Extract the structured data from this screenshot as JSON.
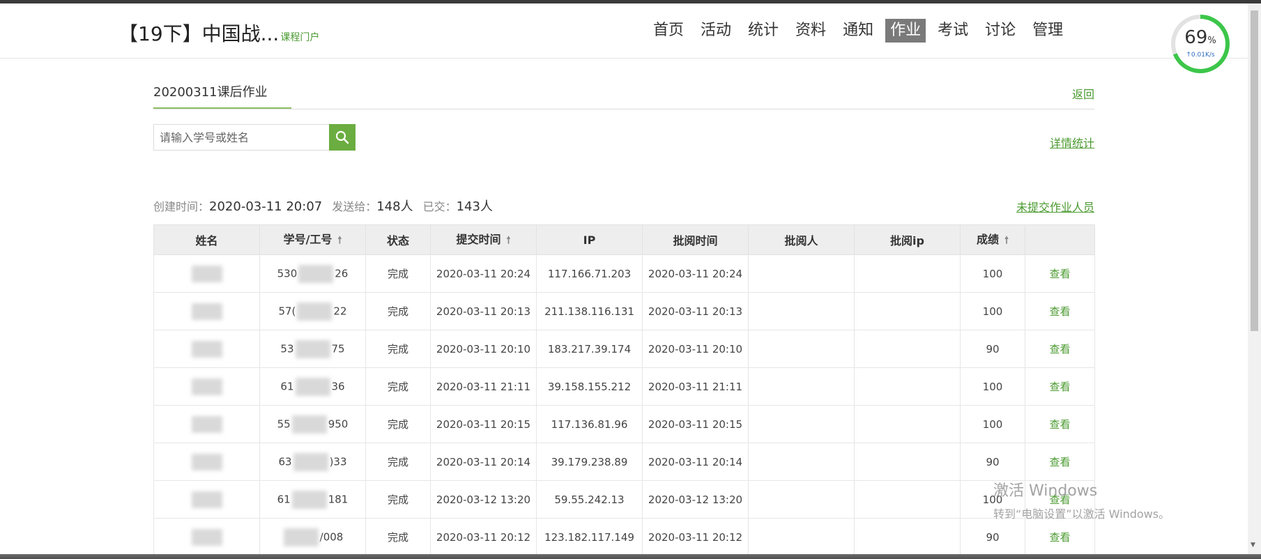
{
  "header": {
    "course_title": "【19下】中国战...",
    "course_portal": "课程门户",
    "nav": [
      {
        "label": "首页",
        "active": false
      },
      {
        "label": "活动",
        "active": false
      },
      {
        "label": "统计",
        "active": false
      },
      {
        "label": "资料",
        "active": false
      },
      {
        "label": "通知",
        "active": false
      },
      {
        "label": "作业",
        "active": true
      },
      {
        "label": "考试",
        "active": false
      },
      {
        "label": "讨论",
        "active": false
      },
      {
        "label": "管理",
        "active": false
      }
    ]
  },
  "meter": {
    "percent": "69",
    "unit": "%",
    "speed": "↑0.01K/s",
    "value": 0.69
  },
  "assignment": {
    "title": "20200311课后作业",
    "back": "返回",
    "search_placeholder": "请输入学号或姓名",
    "detail_stats": "详情统计",
    "created_label": "创建时间：",
    "created_value": "2020-03-11 20:07",
    "sent_label": "发送给：",
    "sent_value": "148人",
    "submitted_label": "已交：",
    "submitted_value": "143人",
    "unsubmitted_link": "未提交作业人员"
  },
  "table": {
    "headers": [
      "姓名",
      "学号/工号",
      "状态",
      "提交时间",
      "IP",
      "批阅时间",
      "批阅人",
      "批阅ip",
      "成绩",
      ""
    ],
    "rows": [
      {
        "id_start": "530",
        "id_end": "26",
        "status": "完成",
        "submit": "2020-03-11 20:24",
        "ip": "117.166.71.203",
        "review": "2020-03-11 20:24",
        "reviewer": "",
        "review_ip": "",
        "score": "100",
        "action": "查看"
      },
      {
        "id_start": "57(",
        "id_end": "22",
        "status": "完成",
        "submit": "2020-03-11 20:13",
        "ip": "211.138.116.131",
        "review": "2020-03-11 20:13",
        "reviewer": "",
        "review_ip": "",
        "score": "100",
        "action": "查看"
      },
      {
        "id_start": "53",
        "id_end": "75",
        "status": "完成",
        "submit": "2020-03-11 20:10",
        "ip": "183.217.39.174",
        "review": "2020-03-11 20:10",
        "reviewer": "",
        "review_ip": "",
        "score": "90",
        "action": "查看"
      },
      {
        "id_start": "61",
        "id_end": "36",
        "status": "完成",
        "submit": "2020-03-11 21:11",
        "ip": "39.158.155.212",
        "review": "2020-03-11 21:11",
        "reviewer": "",
        "review_ip": "",
        "score": "100",
        "action": "查看"
      },
      {
        "id_start": "55",
        "id_end": "950",
        "status": "完成",
        "submit": "2020-03-11 20:15",
        "ip": "117.136.81.96",
        "review": "2020-03-11 20:15",
        "reviewer": "",
        "review_ip": "",
        "score": "100",
        "action": "查看"
      },
      {
        "id_start": "63",
        "id_end": ")33",
        "status": "完成",
        "submit": "2020-03-11 20:14",
        "ip": "39.179.238.89",
        "review": "2020-03-11 20:14",
        "reviewer": "",
        "review_ip": "",
        "score": "90",
        "action": "查看"
      },
      {
        "id_start": "61",
        "id_end": "181",
        "status": "完成",
        "submit": "2020-03-12 13:20",
        "ip": "59.55.242.13",
        "review": "2020-03-12 13:20",
        "reviewer": "",
        "review_ip": "",
        "score": "100",
        "action": "查看"
      },
      {
        "id_start": "",
        "id_end": "/008",
        "status": "完成",
        "submit": "2020-03-11 20:12",
        "ip": "123.182.117.149",
        "review": "2020-03-11 20:12",
        "reviewer": "",
        "review_ip": "",
        "score": "90",
        "action": "查看"
      }
    ]
  },
  "watermark": {
    "line1": "激活 Windows",
    "line2": "转到“电脑设置”以激活 Windows。"
  }
}
